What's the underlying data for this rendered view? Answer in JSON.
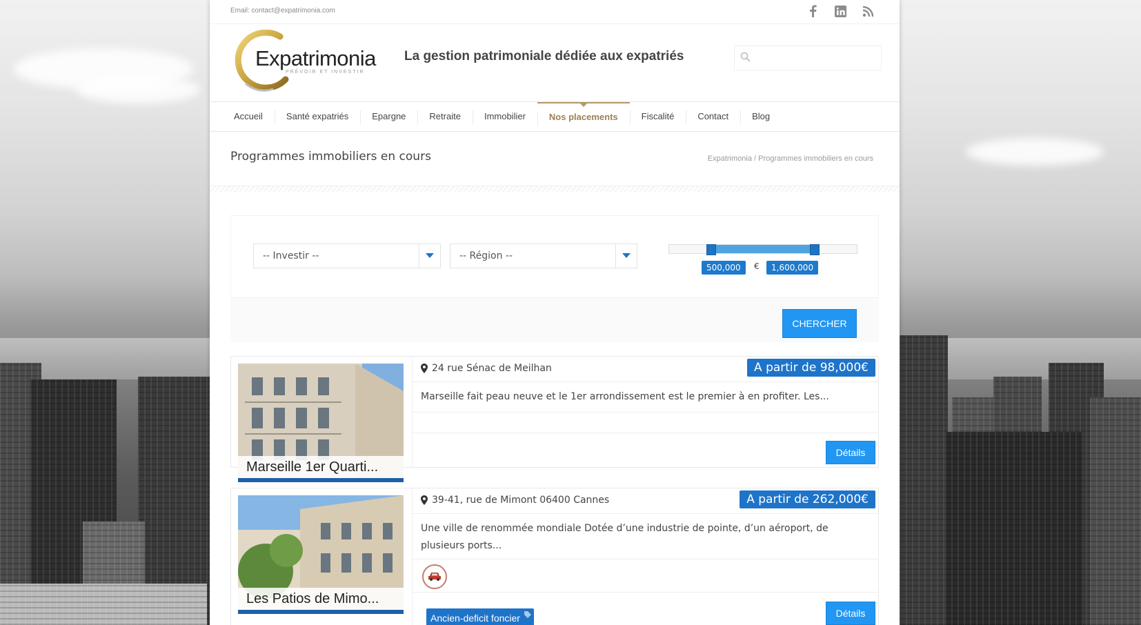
{
  "topbar": {
    "email": "Email: contact@expatrimonia.com",
    "socials": [
      {
        "name": "facebook-icon"
      },
      {
        "name": "linkedin-icon"
      },
      {
        "name": "rss-icon"
      }
    ]
  },
  "header": {
    "logo_text": "Expatrimonia",
    "logo_subtext": "PRÉVOIR ET INVESTIR",
    "tagline": "La gestion patrimoniale dédiée aux expatriés",
    "search_placeholder": ""
  },
  "nav": {
    "items": [
      {
        "label": "Accueil"
      },
      {
        "label": "Santé expatriés"
      },
      {
        "label": "Epargne"
      },
      {
        "label": "Retraite"
      },
      {
        "label": "Immobilier"
      },
      {
        "label": "Nos placements",
        "active": true
      },
      {
        "label": "Fiscalité"
      },
      {
        "label": "Contact"
      },
      {
        "label": "Blog"
      }
    ]
  },
  "page": {
    "title": "Programmes immobiliers en cours",
    "breadcrumb": "Expatrimonia / Programmes immobiliers en cours"
  },
  "filter": {
    "investir": "-- Investir --",
    "region": "-- Région --",
    "price_min": "500,000",
    "price_max": "1,600,000",
    "currency": "€",
    "search_button": "CHERCHER"
  },
  "listings": [
    {
      "caption": "Marseille 1er Quarti...",
      "address": "24 rue Sénac de Meilhan",
      "price": "A partir de 98,000€",
      "description": "Marseille fait peau neuve et le 1er arrondissement est le premier à en profiter. Les...",
      "details_label": "Détails"
    },
    {
      "caption": "Les Patios de Mimo...",
      "address": "39-41, rue de Mimont 06400 Cannes",
      "price": "A partir de 262,000€",
      "description": "Une ville de renommée mondiale Dotée d’une industrie de pointe, d’un aéroport, de plusieurs ports...",
      "badge": "Ancien-deficit foncier",
      "details_label": "Détails"
    }
  ],
  "colors": {
    "accent_blue": "#2196f3",
    "price_blue": "#1e74c9",
    "gold": "#b49a66"
  }
}
